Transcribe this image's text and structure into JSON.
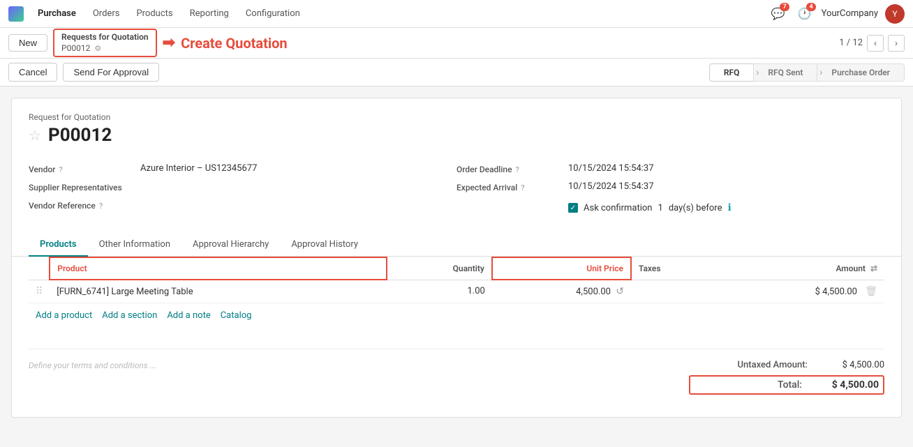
{
  "topnav": {
    "logo_label": "Purchase",
    "menu": [
      {
        "label": "Purchase",
        "active": true
      },
      {
        "label": "Orders"
      },
      {
        "label": "Products"
      },
      {
        "label": "Reporting"
      },
      {
        "label": "Configuration"
      }
    ],
    "notifications_badge": "7",
    "clock_badge": "4",
    "company": "YourCompany",
    "avatar_initials": "Y"
  },
  "breadcrumb": {
    "new_label": "New",
    "rfq_title": "Requests for Quotation",
    "rfq_id": "P00012",
    "arrow": "→",
    "create_label": "Create Quotation",
    "pagination": "1 / 12"
  },
  "actions": {
    "cancel_label": "Cancel",
    "send_for_approval_label": "Send For Approval",
    "status_steps": [
      {
        "label": "RFQ",
        "active": true
      },
      {
        "label": "RFQ Sent",
        "active": false
      },
      {
        "label": "Purchase Order",
        "active": false
      }
    ]
  },
  "form": {
    "subtitle": "Request for Quotation",
    "id": "P00012",
    "vendor_label": "Vendor",
    "vendor_help": "?",
    "vendor_value": "Azure Interior – US12345677",
    "supplier_rep_label": "Supplier Representatives",
    "vendor_ref_label": "Vendor Reference",
    "vendor_ref_help": "?",
    "order_deadline_label": "Order Deadline",
    "order_deadline_help": "?",
    "order_deadline_value": "10/15/2024 15:54:37",
    "expected_arrival_label": "Expected Arrival",
    "expected_arrival_help": "?",
    "expected_arrival_value": "10/15/2024 15:54:37",
    "ask_confirmation_label": "Ask confirmation",
    "ask_confirmation_days": "1",
    "days_before_label": "day(s) before"
  },
  "tabs": [
    {
      "label": "Products",
      "active": true
    },
    {
      "label": "Other Information",
      "active": false
    },
    {
      "label": "Approval Hierarchy",
      "active": false
    },
    {
      "label": "Approval History",
      "active": false
    }
  ],
  "table": {
    "headers": [
      {
        "label": "",
        "key": "drag"
      },
      {
        "label": "Product",
        "key": "product",
        "outlined": true
      },
      {
        "label": "Quantity",
        "key": "quantity"
      },
      {
        "label": "Unit Price",
        "key": "unit_price",
        "outlined": true
      },
      {
        "label": "Taxes",
        "key": "taxes"
      },
      {
        "label": "Amount",
        "key": "amount"
      }
    ],
    "rows": [
      {
        "product": "[FURN_6741] Large Meeting Table",
        "quantity": "1.00",
        "unit_price": "4,500.00",
        "taxes": "",
        "amount": "$ 4,500.00"
      }
    ],
    "add_product": "Add a product",
    "add_section": "Add a section",
    "add_note": "Add a note",
    "catalog": "Catalog"
  },
  "footer": {
    "terms_placeholder": "Define your terms and conditions ...",
    "untaxed_label": "Untaxed Amount:",
    "untaxed_value": "$ 4,500.00",
    "total_label": "Total:",
    "total_value": "$ 4,500.00"
  }
}
